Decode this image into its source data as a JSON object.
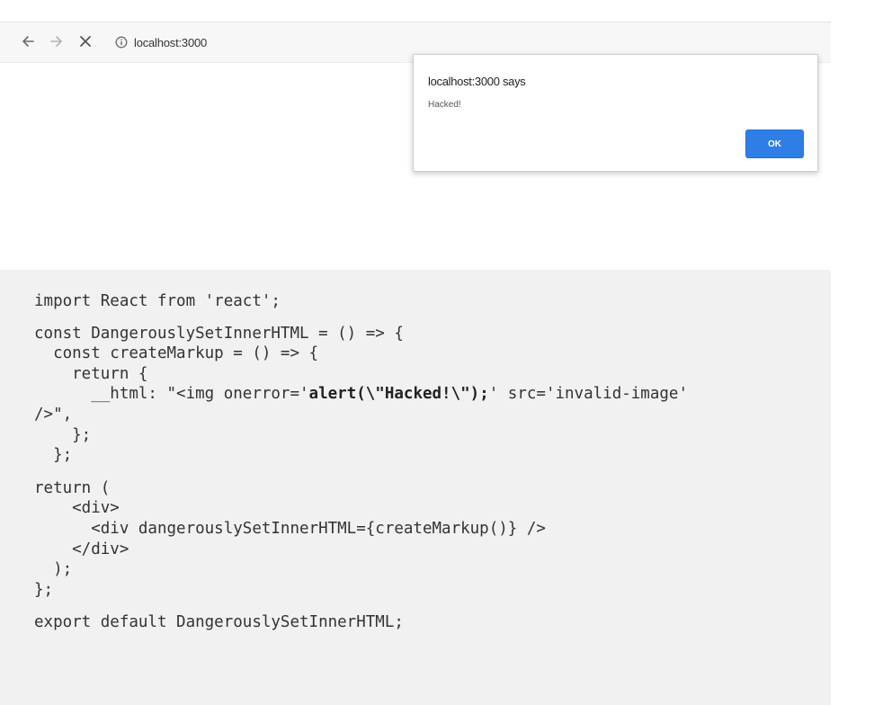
{
  "browser": {
    "url": "localhost:3000"
  },
  "alert": {
    "title": "localhost:3000 says",
    "message": "Hacked!",
    "ok_label": "OK",
    "ok_color": "#2f7ee8"
  },
  "code": {
    "line1": "import React from 'react';",
    "line2": "const DangerouslySetInnerHTML = () => {",
    "line3": "  const createMarkup = () => {",
    "line4": "    return {",
    "line5_pre": "      __html: \"<img onerror='",
    "line5_bold": "alert(\\\"Hacked!\\\");",
    "line5_post": "' src='invalid-image'",
    "line6": "/>\",",
    "line7": "    };",
    "line8": "  };",
    "line9": "return (",
    "line10": "    <div>",
    "line11": "      <div dangerouslySetInnerHTML={createMarkup()} />",
    "line12": "    </div>",
    "line13": "  );",
    "line14": "};",
    "line15": "export default DangerouslySetInnerHTML;"
  }
}
